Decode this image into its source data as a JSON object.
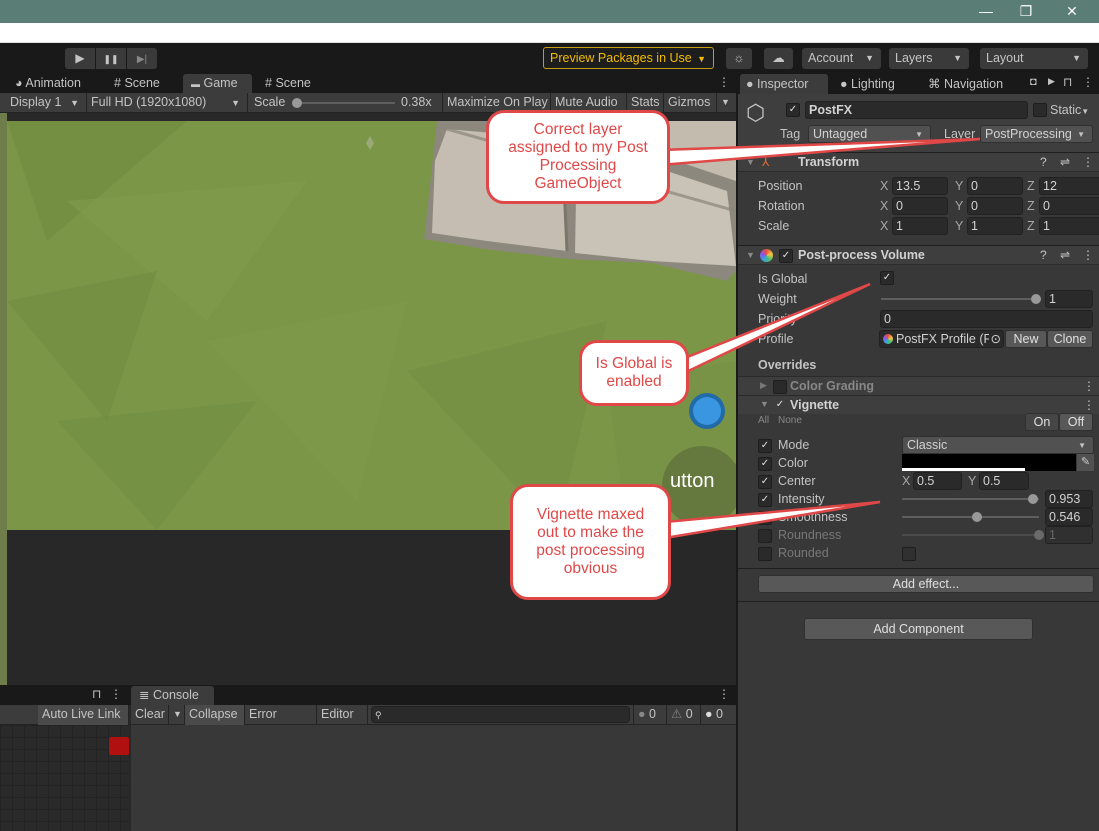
{
  "window": {
    "controls": {
      "minimize": "—",
      "maximize": "❐",
      "close": "✕"
    }
  },
  "toolbar": {
    "play_icon": "▶",
    "pause_icon": "❚❚",
    "step_icon": "▶|",
    "preview_packages": "Preview Packages in Use",
    "account": "Account",
    "layers": "Layers",
    "layout": "Layout",
    "dropdown_arrow": "▼"
  },
  "game_panel": {
    "tabs": [
      {
        "label": "Animation",
        "icon": "clock-icon",
        "glyph": "◕"
      },
      {
        "label": "Scene",
        "icon": "hash-icon",
        "glyph": "#"
      },
      {
        "label": "Game",
        "icon": "gamepad-icon",
        "glyph": "▬"
      },
      {
        "label": "Scene",
        "icon": "hash-icon",
        "glyph": "#"
      }
    ],
    "active_tab": "Game",
    "display": "Display 1",
    "resolution": "Full HD (1920x1080)",
    "scale_label": "Scale",
    "scale_value": "0.38x",
    "scale_fraction": 0.0,
    "maximize_on_play": "Maximize On Play",
    "mute_audio": "Mute Audio",
    "stats": "Stats",
    "gizmos": "Gizmos",
    "viewport": {
      "button_text": "utton",
      "ground_color": "#7a9646",
      "stone_color": "#c4bcb0"
    }
  },
  "bottom": {
    "left_panel": {
      "auto_live_link": "Auto Live Link"
    },
    "console": {
      "tab_label": "Console",
      "clear": "Clear",
      "collapse": "Collapse",
      "error_pause": "Error Pause",
      "editor": "Editor",
      "search_placeholder": "",
      "counts": {
        "info": "0",
        "warning": "0",
        "error": "0"
      }
    }
  },
  "inspector": {
    "tabs": [
      {
        "label": "Inspector",
        "icon": "info-icon"
      },
      {
        "label": "Lighting",
        "icon": "bulb-icon"
      },
      {
        "label": "Navigation",
        "icon": "navigation-icon"
      }
    ],
    "object": {
      "active": true,
      "name": "PostFX",
      "static_label": "Static",
      "static": false,
      "tag_label": "Tag",
      "tag": "Untagged",
      "layer_label": "Layer",
      "layer": "PostProcessing"
    },
    "transform": {
      "title": "Transform",
      "rows": [
        {
          "label": "Position",
          "x": "13.5",
          "y": "0",
          "z": "12"
        },
        {
          "label": "Rotation",
          "x": "0",
          "y": "0",
          "z": "0"
        },
        {
          "label": "Scale",
          "x": "1",
          "y": "1",
          "z": "1"
        }
      ]
    },
    "volume": {
      "title": "Post-process Volume",
      "enabled": true,
      "is_global_label": "Is Global",
      "is_global": true,
      "weight_label": "Weight",
      "weight": "1",
      "weight_fraction": 1.0,
      "priority_label": "Priority",
      "priority": "0",
      "profile_label": "Profile",
      "profile": "PostFX Profile (F",
      "new": "New",
      "clone": "Clone",
      "overrides_label": "Overrides",
      "color_grading": {
        "label": "Color Grading",
        "enabled": false
      },
      "vignette": {
        "label": "Vignette",
        "enabled": true,
        "all": "All",
        "none": "None",
        "on": "On",
        "off": "Off",
        "params": {
          "mode": {
            "label": "Mode",
            "enabled": true,
            "value": "Classic"
          },
          "color": {
            "label": "Color",
            "enabled": true,
            "value": "#000000"
          },
          "center": {
            "label": "Center",
            "enabled": true,
            "x": "0.5",
            "y": "0.5"
          },
          "intensity": {
            "label": "Intensity",
            "enabled": true,
            "value": "0.953",
            "fraction": 0.953
          },
          "smoothness": {
            "label": "Smoothness",
            "enabled": true,
            "value": "0.546",
            "fraction": 0.546
          },
          "roundness": {
            "label": "Roundness",
            "enabled": false,
            "value": "1",
            "fraction": 1.0
          },
          "rounded": {
            "label": "Rounded",
            "enabled": false,
            "value": false
          }
        }
      },
      "add_effect": "Add effect..."
    },
    "add_component": "Add Component"
  },
  "callouts": {
    "layer": "Correct layer assigned to my Post Processing GameObject",
    "global": "Is Global is enabled",
    "vignette": "Vignette maxed out to make the post processing obvious",
    "color": "#e04848"
  }
}
